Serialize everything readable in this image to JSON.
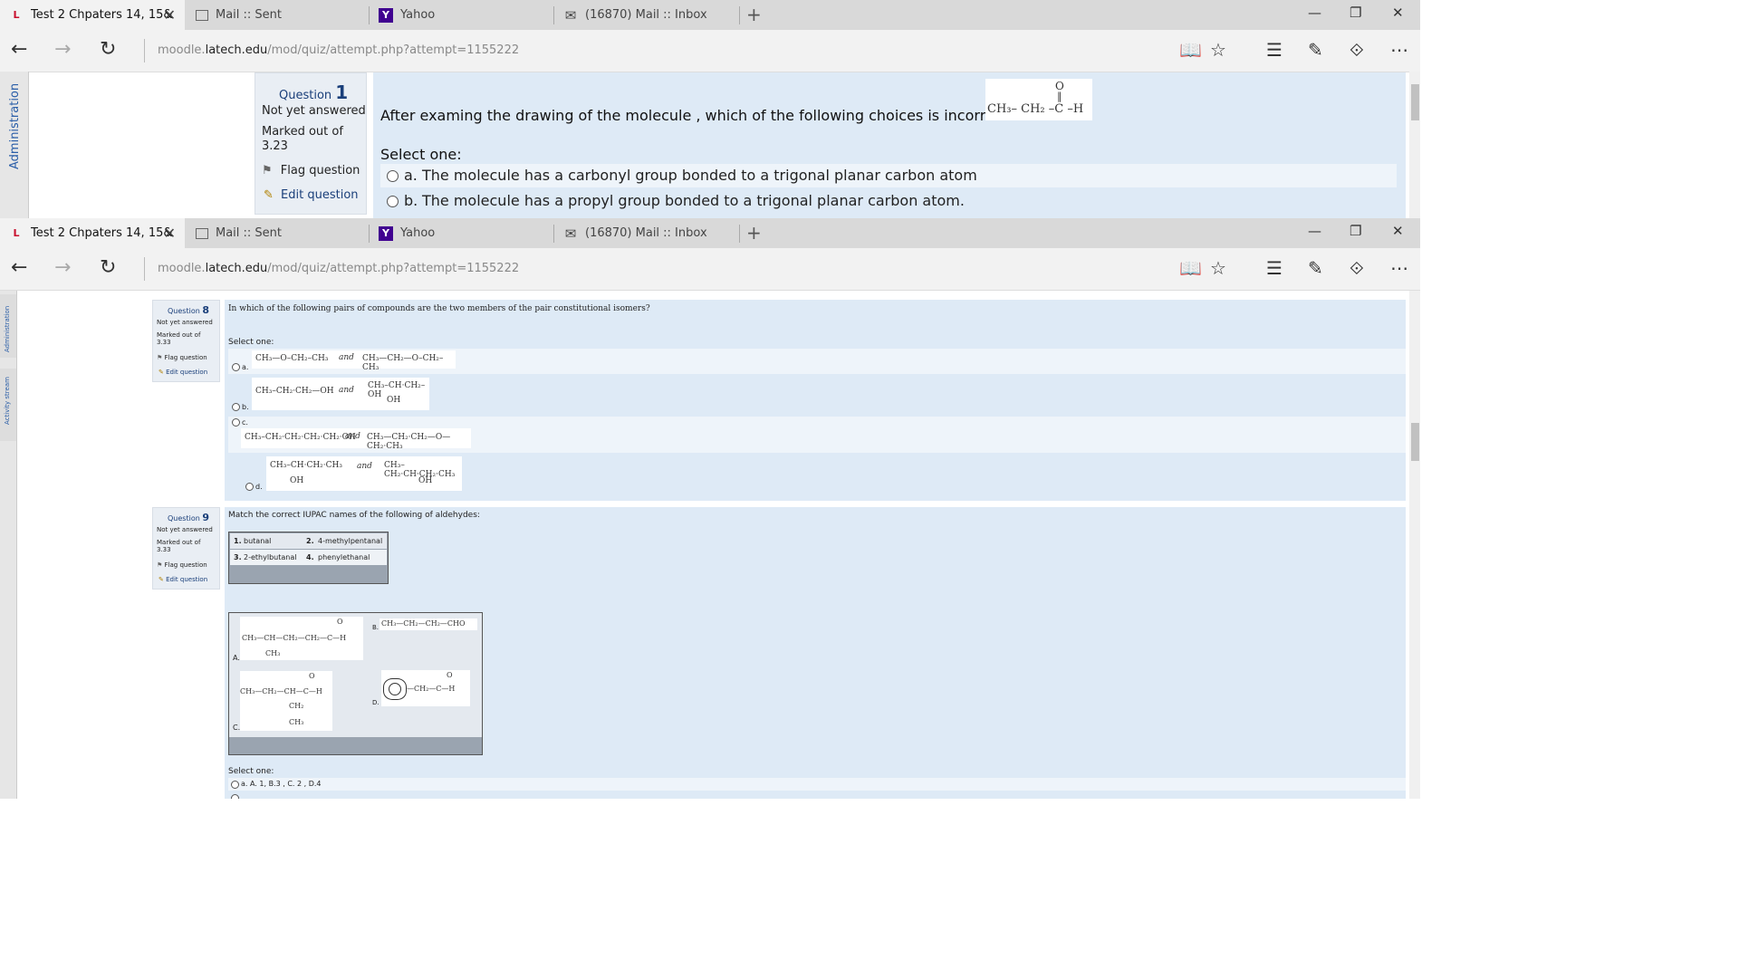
{
  "browser": {
    "tabs": [
      {
        "title": "Test 2 Chpaters 14, 15&",
        "icon": "latech-logo-icon",
        "active": true
      },
      {
        "title": "Mail :: Sent",
        "icon": "page-icon",
        "active": false
      },
      {
        "title": "Yahoo",
        "icon": "yahoo-icon",
        "active": false
      },
      {
        "title": "(16870) Mail :: Inbox",
        "icon": "mail-icon",
        "active": false
      }
    ],
    "url_prefix": "moodle.",
    "url_domain": "latech.edu",
    "url_path": "/mod/quiz/attempt.php?attempt=1155222"
  },
  "top": {
    "sidebar_label": "Administration",
    "question": {
      "label": "Question",
      "number": "1",
      "status": "Not yet answered",
      "marked": "Marked out of 3.23",
      "flag": "Flag question",
      "edit": "Edit question",
      "text": "After examing the drawing of the molecule , which of the following choices is incorrect?",
      "select_one": "Select one:",
      "options": [
        {
          "letter": "a.",
          "text": "The molecule has a carbonyl group bonded to a trigonal planar carbon atom"
        },
        {
          "letter": "b.",
          "text": "The molecule has a propyl group bonded to a trigonal planar carbon atom."
        }
      ],
      "molecule": {
        "o": "O",
        "dbl": "‖",
        "main": "CH₃– CH₂ –C –H"
      }
    }
  },
  "bottom": {
    "sidebar_labels": [
      "Administration",
      "Activity stream"
    ],
    "q8": {
      "label": "Question",
      "number": "8",
      "status": "Not yet answered",
      "marked": "Marked out of 3.33",
      "flag": "Flag question",
      "edit": "Edit question",
      "text": "In which of the following pairs of compounds are the two members of the pair constitutional isomers?",
      "select_one": "Select one:",
      "options": [
        {
          "letter": "a.",
          "left": "CH₃—O–CH₂–CH₃",
          "and": "and",
          "right": "CH₃—CH₂—O–CH₂–CH₃"
        },
        {
          "letter": "b.",
          "left": "CH₃–CH₂·CH₂—OH",
          "and": "and",
          "right": "CH₃–CH·CH₂–OH",
          "right_sub": "OH"
        },
        {
          "letter": "c.",
          "left": "CH₃–CH₂·CH₂·CH₂·CH₂·OH",
          "and": "and",
          "right": "CH₃—CH₂·CH₂—O—CH₂·CH₃"
        },
        {
          "letter": "d.",
          "left": "CH₃–CH·CH₂·CH₃",
          "left_sub": "OH",
          "and": "and",
          "right": "CH₃–CH₂·CH·CH₂·CH₃",
          "right_sub": "OH"
        }
      ]
    },
    "q9": {
      "label": "Question",
      "number": "9",
      "status": "Not yet answered",
      "marked": "Marked out of 3.33",
      "flag": "Flag question",
      "edit": "Edit question",
      "text": "Match the correct IUPAC names of the  following of aldehydes:",
      "names": [
        {
          "num": "1.",
          "name": "butanal"
        },
        {
          "num": "2.",
          "name": "4-methylpentanal"
        },
        {
          "num": "3.",
          "name": "2-ethylbutanal"
        },
        {
          "num": "4.",
          "name": "phenylethanal"
        }
      ],
      "structures": {
        "a_label": "A.",
        "a_top": "O",
        "a_main": "CH₃—CH—CH₂—CH₂—C—H",
        "a_sub": "CH₃",
        "b_label": "B.",
        "b_main": "CH₃—CH₂—CH₂—CHO",
        "c_label": "C.",
        "c_top": "O",
        "c_main": "CH₃—CH₂—CH—C—H",
        "c_sub1": "CH₂",
        "c_sub2": "CH₃",
        "d_label": "D.",
        "d_top": "O",
        "d_main": "—CH₂—C—H"
      },
      "select_one": "Select one:",
      "option_a": "a. A. 1,  B.3 , C. 2 , D.4"
    }
  }
}
